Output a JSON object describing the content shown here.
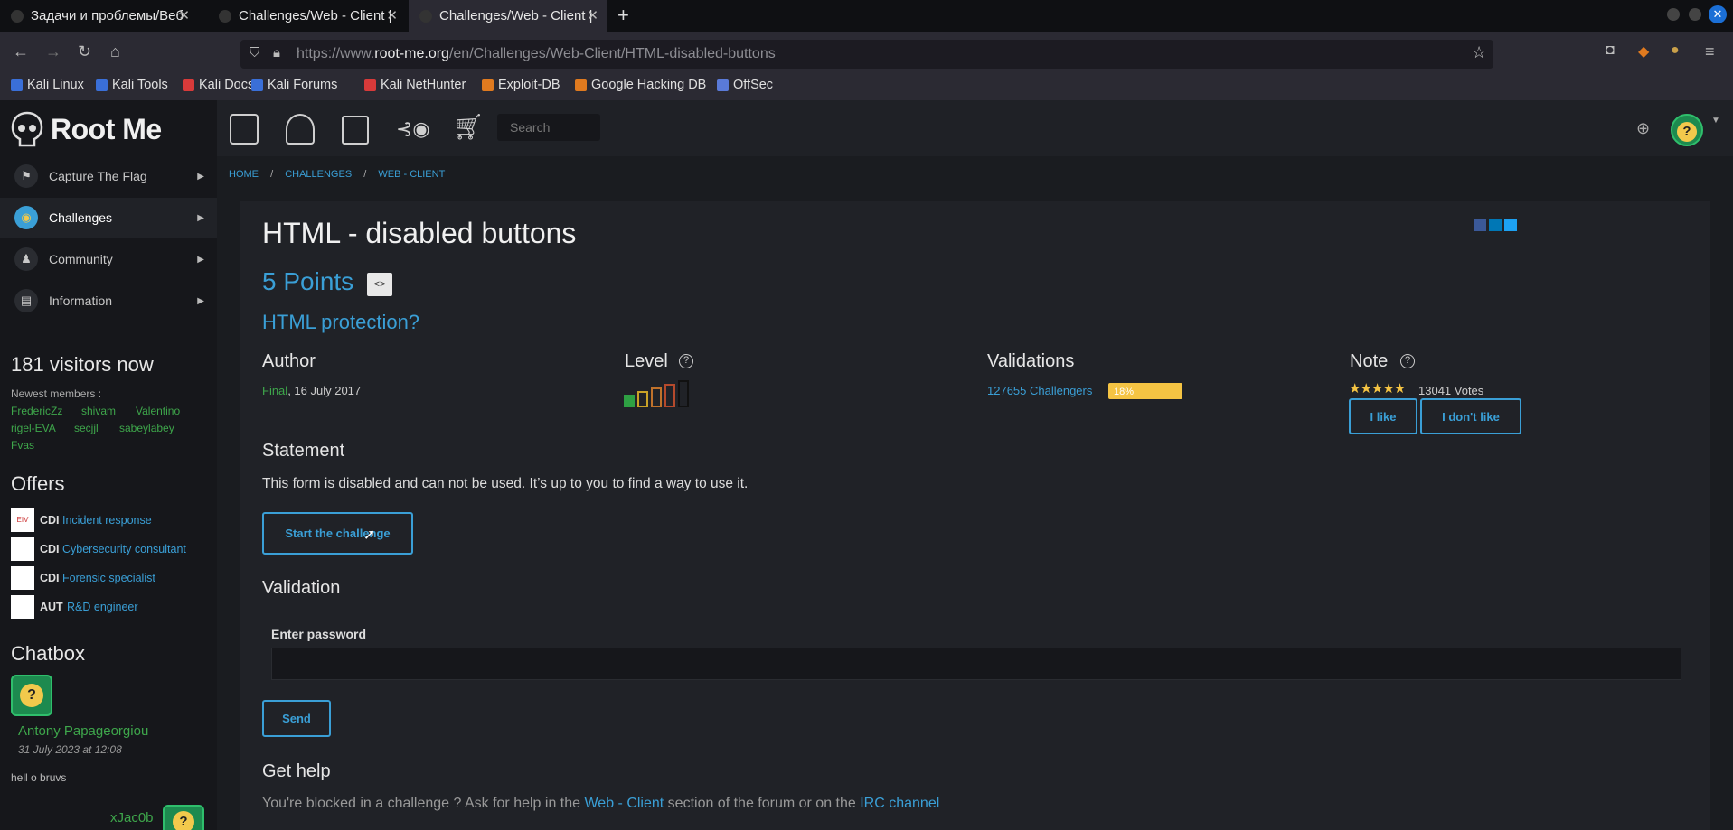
{
  "browser": {
    "tabs": [
      {
        "label": "Задачи и проблемы/Веб"
      },
      {
        "label": "Challenges/Web - Client |"
      },
      {
        "label": "Challenges/Web - Client |"
      }
    ],
    "url_prefix": "https://www.",
    "url_domain": "root-me.org",
    "url_path": "/en/Challenges/Web-Client/HTML-disabled-buttons",
    "bookmarks": [
      {
        "label": "Kali Linux",
        "color": "#3a6fd8"
      },
      {
        "label": "Kali Tools",
        "color": "#3a6fd8"
      },
      {
        "label": "Kali Docs",
        "color": "#d83a3a"
      },
      {
        "label": "Kali Forums",
        "color": "#3a6fd8"
      },
      {
        "label": "Kali NetHunter",
        "color": "#d83a3a"
      },
      {
        "label": "Exploit-DB",
        "color": "#e07a1f"
      },
      {
        "label": "Google Hacking DB",
        "color": "#e07a1f"
      },
      {
        "label": "OffSec",
        "color": "#5a7ad8"
      }
    ]
  },
  "site": {
    "logo_text": "Root Me",
    "search_placeholder": "Search"
  },
  "sidebar": {
    "items": [
      {
        "label": "Capture The Flag"
      },
      {
        "label": "Challenges"
      },
      {
        "label": "Community"
      },
      {
        "label": "Information"
      }
    ],
    "visitors": "181 visitors now",
    "newest_label": "Newest members :",
    "members": [
      "FredericZz",
      "shivam",
      "Valentino",
      "rigel-EVA",
      "secjjl",
      "sabeylabey",
      "Fvas"
    ],
    "offers_title": "Offers",
    "offers": [
      {
        "type": "CDI",
        "title": "Incident response",
        "logo": "EIV"
      },
      {
        "type": "CDI",
        "title": "Cybersecurity consultant",
        "logo": ""
      },
      {
        "type": "CDI",
        "title": "Forensic specialist",
        "logo": ""
      },
      {
        "type": "AUT",
        "title": "R&D engineer",
        "logo": ""
      }
    ],
    "chatbox_title": "Chatbox",
    "chat_user": "Antony Papageorgiou",
    "chat_time": "31 July 2023 at 12:08",
    "chat_msg": "hell o bruvs",
    "chat_user2": "xJac0b"
  },
  "breadcrumb": [
    "HOME",
    "/",
    "CHALLENGES",
    "/",
    "WEB - CLIENT"
  ],
  "challenge": {
    "title": "HTML - disabled buttons",
    "points": "5 Points",
    "subtitle": "HTML protection?",
    "author_label": "Author",
    "author_name": "Final",
    "author_date": ",  16 July 2017",
    "level_label": "Level",
    "level": 1,
    "level_max": 5,
    "validations_label": "Validations",
    "validations_count": "127655 Challengers",
    "validations_pct": "18%",
    "note_label": "Note",
    "stars": "★★★★★",
    "votes": "13041 Votes",
    "like_label": "I like",
    "dislike_label": "I don't like",
    "statement_label": "Statement",
    "statement_text": "This form is disabled and can not be used. It’s up to you to find a way to use it.",
    "start_label": "Start the challenge",
    "validation_label": "Validation",
    "password_label": "Enter password",
    "send_label": "Send",
    "gethelp_label": "Get help",
    "help_pre": "You're blocked in a challenge ? Ask for help in the ",
    "help_link1": "Web - Client",
    "help_mid": " section of the forum or on the ",
    "help_link2": "IRC channel"
  }
}
